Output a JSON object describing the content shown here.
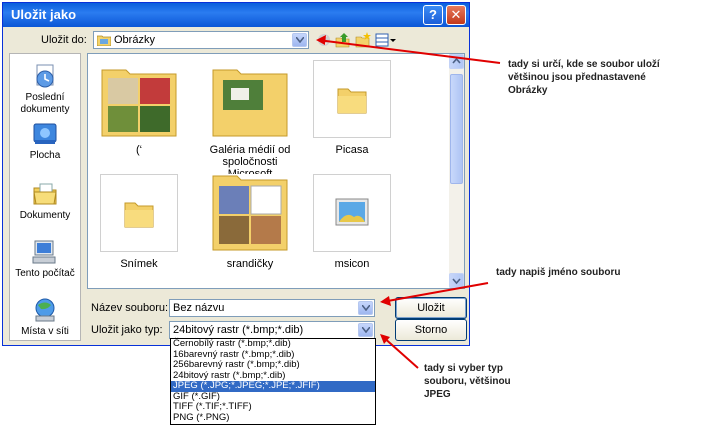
{
  "window": {
    "title": "Uložit jako",
    "help_glyph": "?",
    "close_glyph": "✕"
  },
  "save_in": {
    "label": "Uložit do:",
    "value": "Obrázky"
  },
  "places": [
    {
      "label": "Poslední dokumenty",
      "icon": "recent-documents-icon"
    },
    {
      "label": "Plocha",
      "icon": "desktop-icon"
    },
    {
      "label": "Dokumenty",
      "icon": "documents-icon"
    },
    {
      "label": "Tento počítač",
      "icon": "my-computer-icon"
    },
    {
      "label": "Místa v síti",
      "icon": "network-places-icon"
    }
  ],
  "files": [
    {
      "label": "(‘",
      "kind": "folder-photos"
    },
    {
      "label": "Galéria médií od spoločnosti Microsoft",
      "kind": "folder-photos"
    },
    {
      "label": "Picasa",
      "kind": "folder"
    },
    {
      "label": "Snímek",
      "kind": "folder"
    },
    {
      "label": "srandičky",
      "kind": "folder-photos"
    },
    {
      "label": "msicon",
      "kind": "image"
    }
  ],
  "filename": {
    "label": "Název souboru:",
    "value": "Bez názvu"
  },
  "filetype": {
    "label": "Uložit jako typ:",
    "value": "24bitový rastr (*.bmp;*.dib)",
    "options": [
      "Černobílý rastr (*.bmp;*.dib)",
      "16barevný rastr (*.bmp;*.dib)",
      "256barevný rastr (*.bmp;*.dib)",
      "24bitový rastr (*.bmp;*.dib)",
      "JPEG (*.JPG;*.JPEG;*.JPE;*.JFIF)",
      "GIF (*.GIF)",
      "TIFF (*.TIF;*.TIFF)",
      "PNG (*.PNG)"
    ],
    "selected_index": 4
  },
  "buttons": {
    "save": "Uložit",
    "cancel": "Storno"
  },
  "annotations": {
    "save_location": [
      "tady si určí, kde se soubor uloží",
      "většinou  jsou přednastavené",
      "Obrázky"
    ],
    "filename": [
      "tady napiš jméno souboru"
    ],
    "filetype": [
      "tady si vyber typ",
      "souboru, většinou",
      "JPEG"
    ]
  },
  "colors": {
    "titlebar": "#0a5fdc",
    "dialog": "#ece9d8",
    "selection": "#316ac5",
    "annotation_arrow": "#e00000"
  }
}
